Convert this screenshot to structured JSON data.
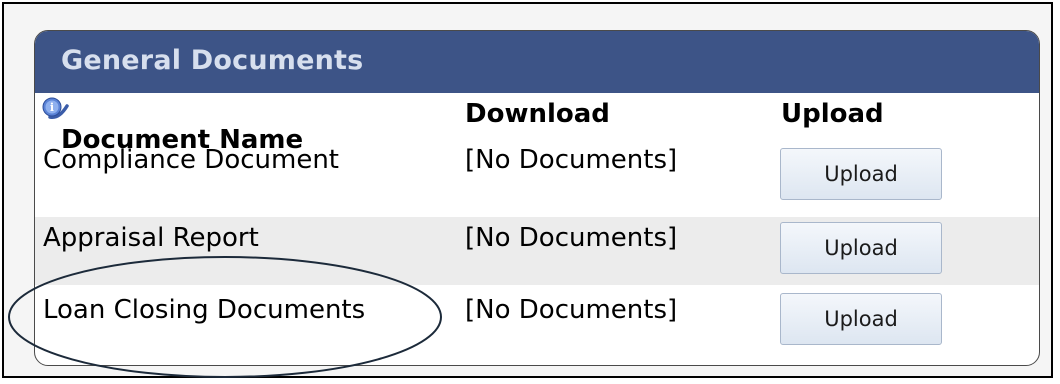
{
  "panel": {
    "title": "General Documents",
    "columns": {
      "name": "Document Name",
      "download": "Download",
      "upload": "Upload"
    }
  },
  "rows": [
    {
      "name": "Compliance Document",
      "download": "[No Documents]",
      "upload_button": "Upload"
    },
    {
      "name": "Appraisal Report",
      "download": "[No Documents]",
      "upload_button": "Upload"
    },
    {
      "name": "Loan Closing Documents",
      "download": "[No Documents]",
      "upload_button": "Upload"
    }
  ],
  "icons": {
    "info": "info-icon"
  },
  "colors": {
    "header_bg": "#3d5487",
    "header_text": "#d7dfee",
    "alt_row_bg": "#ececec",
    "button_border": "#a9b7cb"
  }
}
